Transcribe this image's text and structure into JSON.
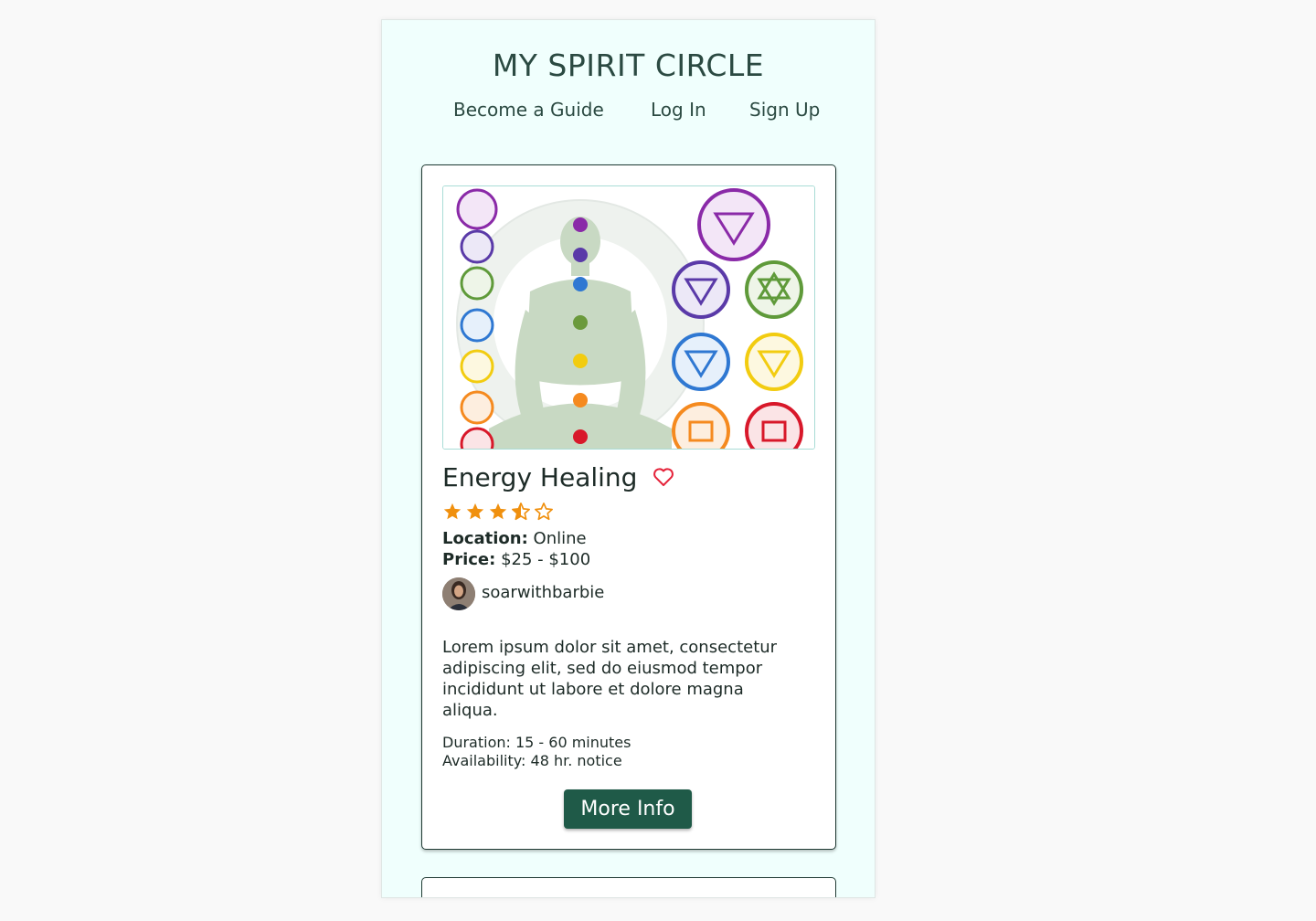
{
  "header": {
    "site_title": "MY SPIRIT CIRCLE",
    "nav": [
      {
        "label": "Become a Guide"
      },
      {
        "label": "Log In"
      },
      {
        "label": "Sign Up"
      }
    ]
  },
  "listing": {
    "image_alt": "Chakra symbols with meditating figure",
    "title": "Energy Healing",
    "favorite_icon": "heart-icon",
    "rating": 3.5,
    "rating_max": 5,
    "location_label": "Location:",
    "location_value": "Online",
    "price_label": "Price:",
    "price_value": "$25 - $100",
    "guide_username": "soarwithbarbie",
    "description": "Lorem ipsum dolor sit amet, consectetur adipiscing elit, sed do eiusmod tempor incididunt ut labore et dolore magna aliqua.",
    "duration": "Duration: 15 - 60 minutes",
    "availability": "Availability: 48 hr. notice",
    "button_label": "More Info"
  },
  "colors": {
    "background": "#f0fffd",
    "accent": "#1f5a48",
    "star": "#f0900e",
    "heart": "#e5233a"
  }
}
